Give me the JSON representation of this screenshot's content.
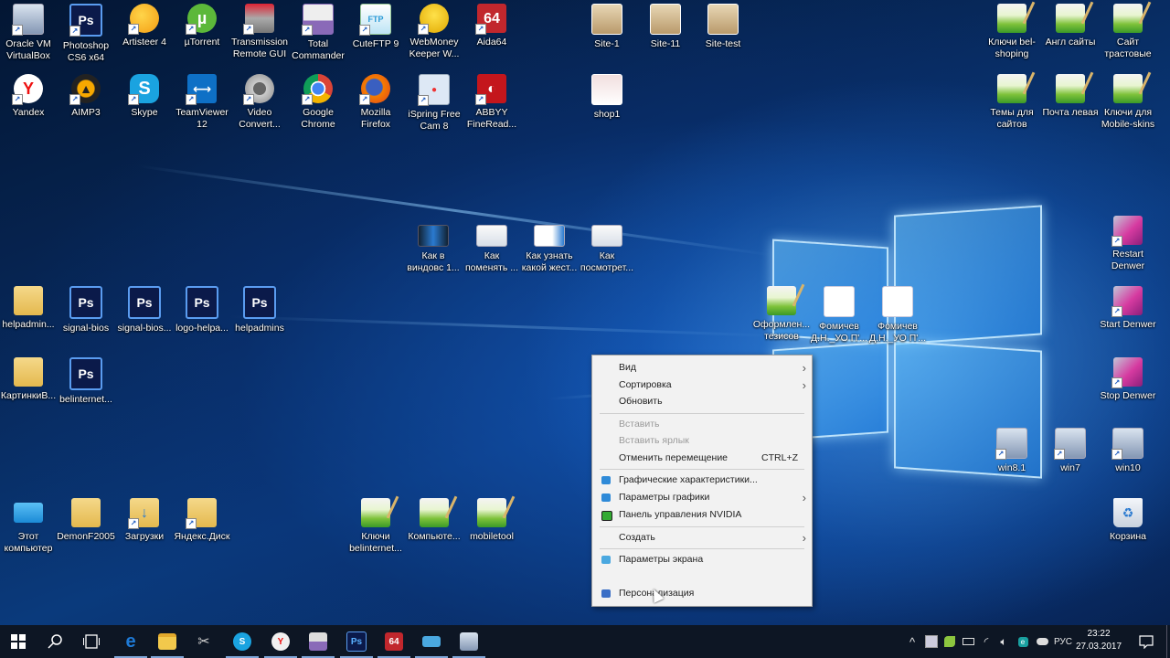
{
  "desktop": {
    "icons_row1": [
      {
        "label": "Oracle VM VirtualBox",
        "icon": "virtualbox-icon",
        "shortcut": true
      },
      {
        "label": "Photoshop CS6 x64",
        "icon": "photoshop-icon",
        "shortcut": true
      },
      {
        "label": "Artisteer 4",
        "icon": "artisteer-icon",
        "shortcut": true
      },
      {
        "label": "µTorrent",
        "icon": "utorrent-icon",
        "shortcut": true
      },
      {
        "label": "Transmission Remote GUI",
        "icon": "transmission-icon",
        "shortcut": true
      },
      {
        "label": "Total Commander",
        "icon": "total-commander-icon",
        "shortcut": true
      },
      {
        "label": "CuteFTP 9",
        "icon": "cuteftp-icon",
        "shortcut": true
      },
      {
        "label": "WebMoney Keeper W...",
        "icon": "webmoney-icon",
        "shortcut": true
      },
      {
        "label": "Aida64",
        "icon": "aida64-icon",
        "shortcut": true
      }
    ],
    "icons_row2": [
      {
        "label": "Yandex",
        "icon": "yandex-browser-icon",
        "shortcut": true
      },
      {
        "label": "AIMP3",
        "icon": "aimp-icon",
        "shortcut": true
      },
      {
        "label": "Skype",
        "icon": "skype-icon",
        "shortcut": true
      },
      {
        "label": "TeamViewer 12",
        "icon": "teamviewer-icon",
        "shortcut": true
      },
      {
        "label": "Video Convert...",
        "icon": "video-converter-icon",
        "shortcut": true
      },
      {
        "label": "Google Chrome",
        "icon": "chrome-icon",
        "shortcut": true
      },
      {
        "label": "Mozilla Firefox",
        "icon": "firefox-icon",
        "shortcut": true
      },
      {
        "label": "iSpring Free Cam 8",
        "icon": "ispring-icon",
        "shortcut": true
      },
      {
        "label": "ABBYY FineRead...",
        "icon": "abbyy-icon",
        "shortcut": true
      }
    ],
    "site_thumbs": [
      {
        "label": "Site-1"
      },
      {
        "label": "Site-11"
      },
      {
        "label": "Site-test"
      },
      {
        "label": "shop1"
      }
    ],
    "notepad_top_right": [
      {
        "label": "Ключи bel-shoping"
      },
      {
        "label": "Англ сайты"
      },
      {
        "label": "Сайт трастовые"
      },
      {
        "label": "Темы для сайтов"
      },
      {
        "label": "Почта левая"
      },
      {
        "label": "Ключи для Mobile-skins"
      }
    ],
    "screenshots_middle": [
      {
        "label": "Как в виндовс 1..."
      },
      {
        "label": "Как поменять ..."
      },
      {
        "label": "Как узнать какой жест..."
      },
      {
        "label": "Как посмотрет..."
      }
    ],
    "left_files_row1": [
      {
        "label": "helpadmin...",
        "icon": "folder-icon"
      },
      {
        "label": "signal-bios",
        "icon": "photoshop-file-icon"
      },
      {
        "label": "signal-bios...",
        "icon": "photoshop-file-icon"
      },
      {
        "label": "logo-helpa...",
        "icon": "photoshop-file-icon"
      },
      {
        "label": "helpadmins",
        "icon": "photoshop-file-icon"
      }
    ],
    "left_files_row2": [
      {
        "label": "КартинкиВ...",
        "icon": "folder-icon"
      },
      {
        "label": "belinternet...",
        "icon": "photoshop-file-icon"
      }
    ],
    "center_docs": [
      {
        "label": "Оформлен... тезисов",
        "icon": "notepad-file-icon"
      },
      {
        "label": "Фомичев Д.Н._УО П'...",
        "icon": "word-doc-icon"
      },
      {
        "label": "Фомичев Д.Н._УО П'...",
        "icon": "word-doc-icon"
      }
    ],
    "denwer": [
      {
        "label": "Restart Denwer"
      },
      {
        "label": "Start Denwer"
      },
      {
        "label": "Stop Denwer"
      }
    ],
    "vms": [
      {
        "label": "win8.1"
      },
      {
        "label": "win7"
      },
      {
        "label": "win10"
      }
    ],
    "recycle_bin": {
      "label": "Корзина"
    },
    "bottom_left": [
      {
        "label": "Этот компьютер",
        "icon": "this-pc-icon"
      },
      {
        "label": "DemonF2005",
        "icon": "user-folder-icon"
      },
      {
        "label": "Загрузки",
        "icon": "downloads-folder-icon"
      },
      {
        "label": "Яндекс.Диск",
        "icon": "yandex-disk-icon"
      }
    ],
    "bottom_mid": [
      {
        "label": "Ключи belinternet..."
      },
      {
        "label": "Компьюте..."
      },
      {
        "label": "mobiletool"
      }
    ]
  },
  "context_menu": {
    "items": [
      {
        "label": "Вид",
        "submenu": true
      },
      {
        "label": "Сортировка",
        "submenu": true
      },
      {
        "label": "Обновить"
      },
      {
        "label": "Вставить",
        "disabled": true
      },
      {
        "label": "Вставить ярлык",
        "disabled": true
      },
      {
        "label": "Отменить перемещение",
        "shortcut": "CTRL+Z"
      },
      {
        "label": "Графические характеристики...",
        "icon": "intel-graphics-icon"
      },
      {
        "label": "Параметры графики",
        "icon": "intel-graphics-icon",
        "submenu": true
      },
      {
        "label": "Панель управления NVIDIA",
        "icon": "nvidia-icon"
      },
      {
        "label": "Создать",
        "submenu": true
      },
      {
        "label": "Параметры экрана",
        "icon": "display-settings-icon"
      },
      {
        "label": "Персонализация",
        "icon": "personalization-icon"
      }
    ],
    "arrow_glyph": "›"
  },
  "taskbar": {
    "pinned": [
      {
        "name": "edge",
        "glyph": "e",
        "color": "#1e7ad6"
      },
      {
        "name": "file-explorer",
        "glyph": "",
        "color": "#f2c94c"
      },
      {
        "name": "snipping-tool",
        "glyph": "✂",
        "color": "#555"
      },
      {
        "name": "skype",
        "glyph": "S",
        "color": "#1aa3e0"
      },
      {
        "name": "yandex-browser",
        "glyph": "Y",
        "color": "#e8e8e8"
      },
      {
        "name": "total-commander",
        "glyph": "▬",
        "color": "#8a6ab8"
      },
      {
        "name": "photoshop",
        "glyph": "Ps",
        "color": "#0b1a4a"
      },
      {
        "name": "aida64",
        "glyph": "64",
        "color": "#c1272d"
      },
      {
        "name": "remote-desktop",
        "glyph": "▭",
        "color": "#4aa8e0"
      },
      {
        "name": "virtualbox",
        "glyph": "⬡",
        "color": "#9aaac4"
      }
    ],
    "tray": {
      "language": "РУС",
      "time": "23:22",
      "date": "27.03.2017"
    }
  },
  "colors": {
    "menu_bg": "#f2f2f2",
    "taskbar_bg": "#0d1624",
    "taskbar_active_underline": "#7fa6d8"
  }
}
